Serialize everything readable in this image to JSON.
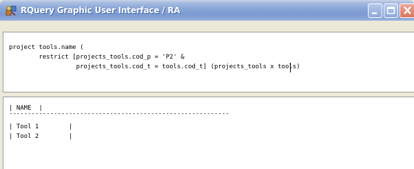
{
  "window": {
    "title": "RQuery Graphic User Interface / RA",
    "icon": "app-icon"
  },
  "query_editor": {
    "lines": [
      "project tools.name (",
      "        restrict [projects_tools.cod_p = 'P2' &",
      "                  projects_tools.cod_t = tools.cod_t] (projects_tools x tools)"
    ]
  },
  "results": {
    "header": "| NAME  |",
    "separator": "-----------------------------------------------------------",
    "rows": [
      "| Tool 1        |",
      "| Tool 2        |"
    ]
  },
  "colors": {
    "titlebar": "#7c9ad2",
    "close_button": "#d8755e",
    "window_bg": "#ece9d8",
    "pane_bg": "#ffffff"
  }
}
